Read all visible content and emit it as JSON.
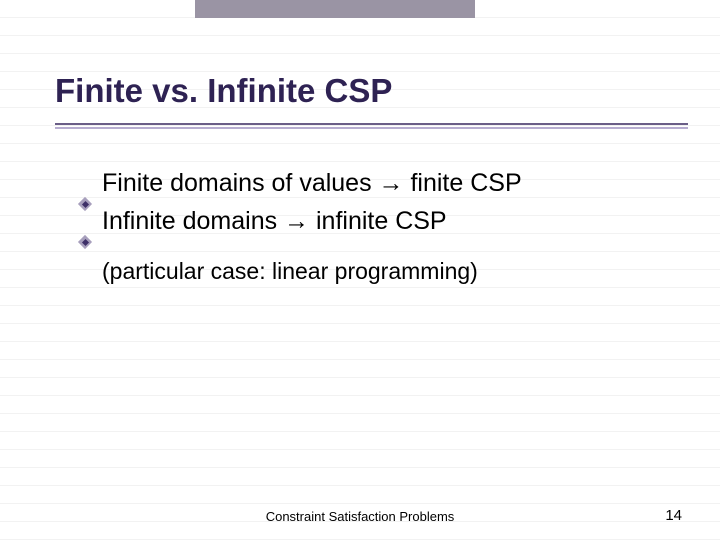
{
  "title": "Finite vs. Infinite CSP",
  "bullets": [
    {
      "prefix": "Finite domains of values ",
      "arrow": "→",
      "suffix": " finite CSP"
    },
    {
      "prefix": "Infinite domains ",
      "arrow": "→",
      "suffix": " infinite CSP"
    }
  ],
  "note": "(particular case: linear programming)",
  "footer": {
    "center": "Constraint Satisfaction Problems",
    "page": "14"
  }
}
